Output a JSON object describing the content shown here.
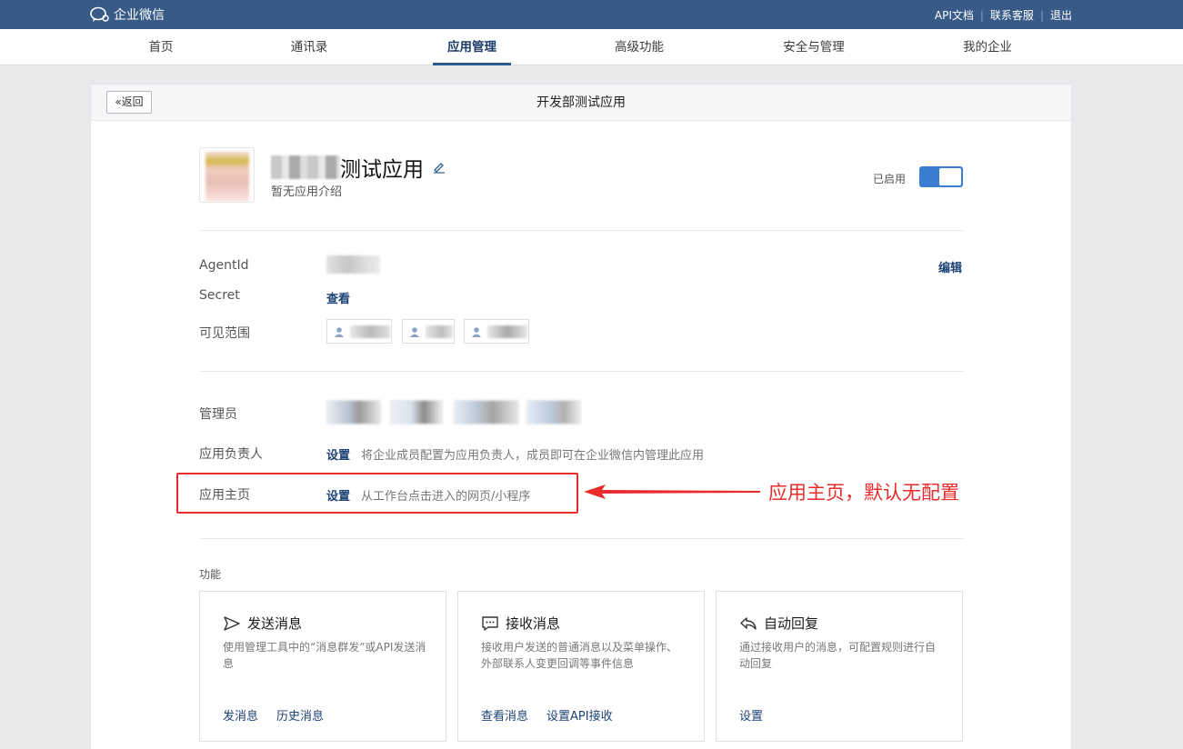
{
  "topbar": {
    "brand": "企业微信",
    "links": [
      "API文档",
      "联系客服",
      "退出"
    ]
  },
  "nav": {
    "items": [
      "首页",
      "通讯录",
      "应用管理",
      "高级功能",
      "安全与管理",
      "我的企业"
    ],
    "active": "应用管理"
  },
  "panel": {
    "back_label": "返回",
    "title": "开发部测试应用"
  },
  "app": {
    "name_suffix": "测试应用",
    "description": "暂无应用介绍",
    "status_label": "已启用",
    "enabled": true
  },
  "details": {
    "agentid_label": "AgentId",
    "edit_label": "编辑",
    "secret_label": "Secret",
    "secret_action": "查看",
    "visible_label": "可见范围",
    "admin_label": "管理员",
    "owner_label": "应用负责人",
    "owner_action": "设置",
    "owner_hint": "将企业成员配置为应用负责人，成员即可在企业微信内管理此应用",
    "homepage_label": "应用主页",
    "homepage_action": "设置",
    "homepage_hint": "从工作台点击进入的网页/小程序"
  },
  "annotation": {
    "text": "应用主页，默认无配置",
    "color": "#ea2b2b"
  },
  "features": {
    "section_label": "功能",
    "cards": [
      {
        "title": "发送消息",
        "icon": "send-icon",
        "desc": "使用管理工具中的“消息群发”或API发送消息",
        "links": [
          "发消息",
          "历史消息"
        ]
      },
      {
        "title": "接收消息",
        "icon": "message-icon",
        "desc": "接收用户发送的普通消息以及菜单操作、外部联系人变更回调等事件信息",
        "links": [
          "查看消息",
          "设置API接收"
        ]
      },
      {
        "title": "自动回复",
        "icon": "reply-icon",
        "desc": "通过接收用户的消息，可配置规则进行自动回复",
        "links": [
          "设置"
        ]
      }
    ]
  }
}
